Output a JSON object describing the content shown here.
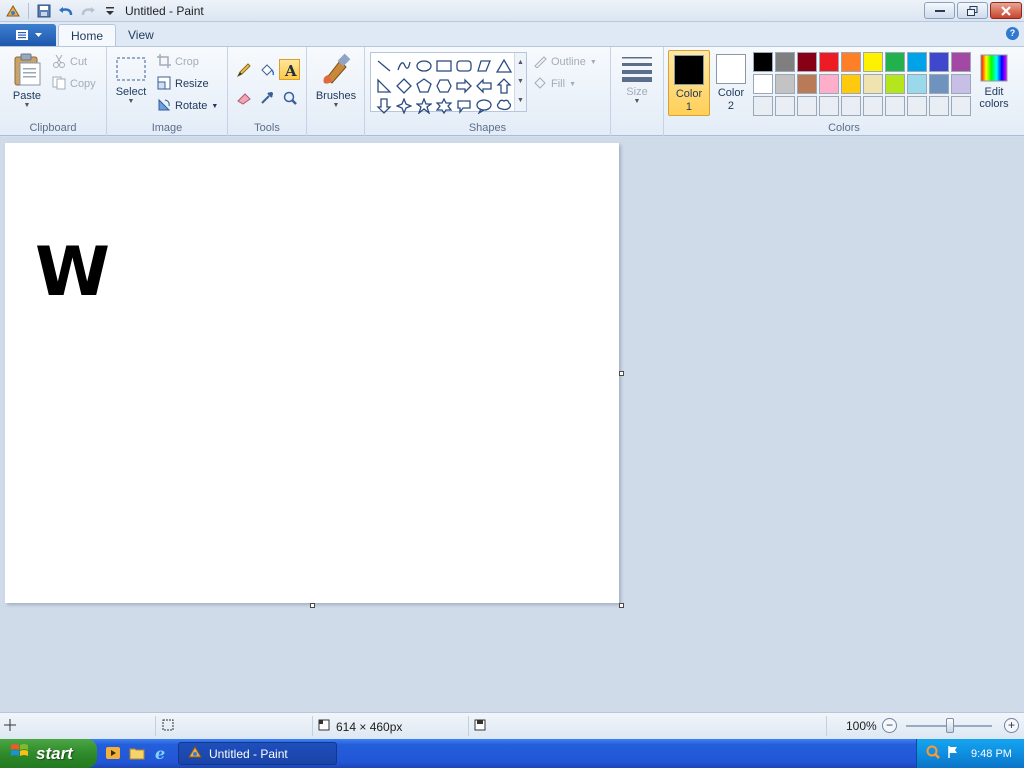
{
  "window": {
    "title": "Untitled - Paint"
  },
  "tabs": [
    {
      "label": "Home"
    },
    {
      "label": "View"
    }
  ],
  "clipboard": {
    "paste_label": "Paste",
    "cut_label": "Cut",
    "copy_label": "Copy",
    "group_label": "Clipboard"
  },
  "image": {
    "select_label": "Select",
    "crop_label": "Crop",
    "resize_label": "Resize",
    "rotate_label": "Rotate",
    "group_label": "Image"
  },
  "tools": {
    "group_label": "Tools"
  },
  "brushes": {
    "label": "Brushes"
  },
  "shapes": {
    "group_label": "Shapes",
    "outline_label": "Outline",
    "fill_label": "Fill"
  },
  "size": {
    "label": "Size"
  },
  "colors": {
    "color1_line1": "Color",
    "color1_line2": "1",
    "color2_line1": "Color",
    "color2_line2": "2",
    "edit_line1": "Edit",
    "edit_line2": "colors",
    "group_label": "Colors",
    "color1_value": "#000000",
    "color2_value": "#ffffff",
    "palette": [
      "#000000",
      "#7f7f7f",
      "#880015",
      "#ed1c24",
      "#ff7f27",
      "#fff200",
      "#22b14c",
      "#00a2e8",
      "#3f48cc",
      "#a349a4",
      "#ffffff",
      "#c3c3c3",
      "#b97a57",
      "#ffaec9",
      "#ffc90e",
      "#efe4b0",
      "#b5e61d",
      "#99d9ea",
      "#7092be",
      "#c8bfe7",
      "#e9eef5",
      "#e9eef5",
      "#e9eef5",
      "#e9eef5",
      "#e9eef5",
      "#e9eef5",
      "#e9eef5",
      "#e9eef5",
      "#e9eef5",
      "#e9eef5"
    ]
  },
  "canvas": {
    "text": "W"
  },
  "status": {
    "dimensions": "614 × 460px",
    "zoom": "100%"
  },
  "taskbar": {
    "start_label": "start",
    "task_label": "Untitled - Paint",
    "clock": "9:48 PM"
  }
}
